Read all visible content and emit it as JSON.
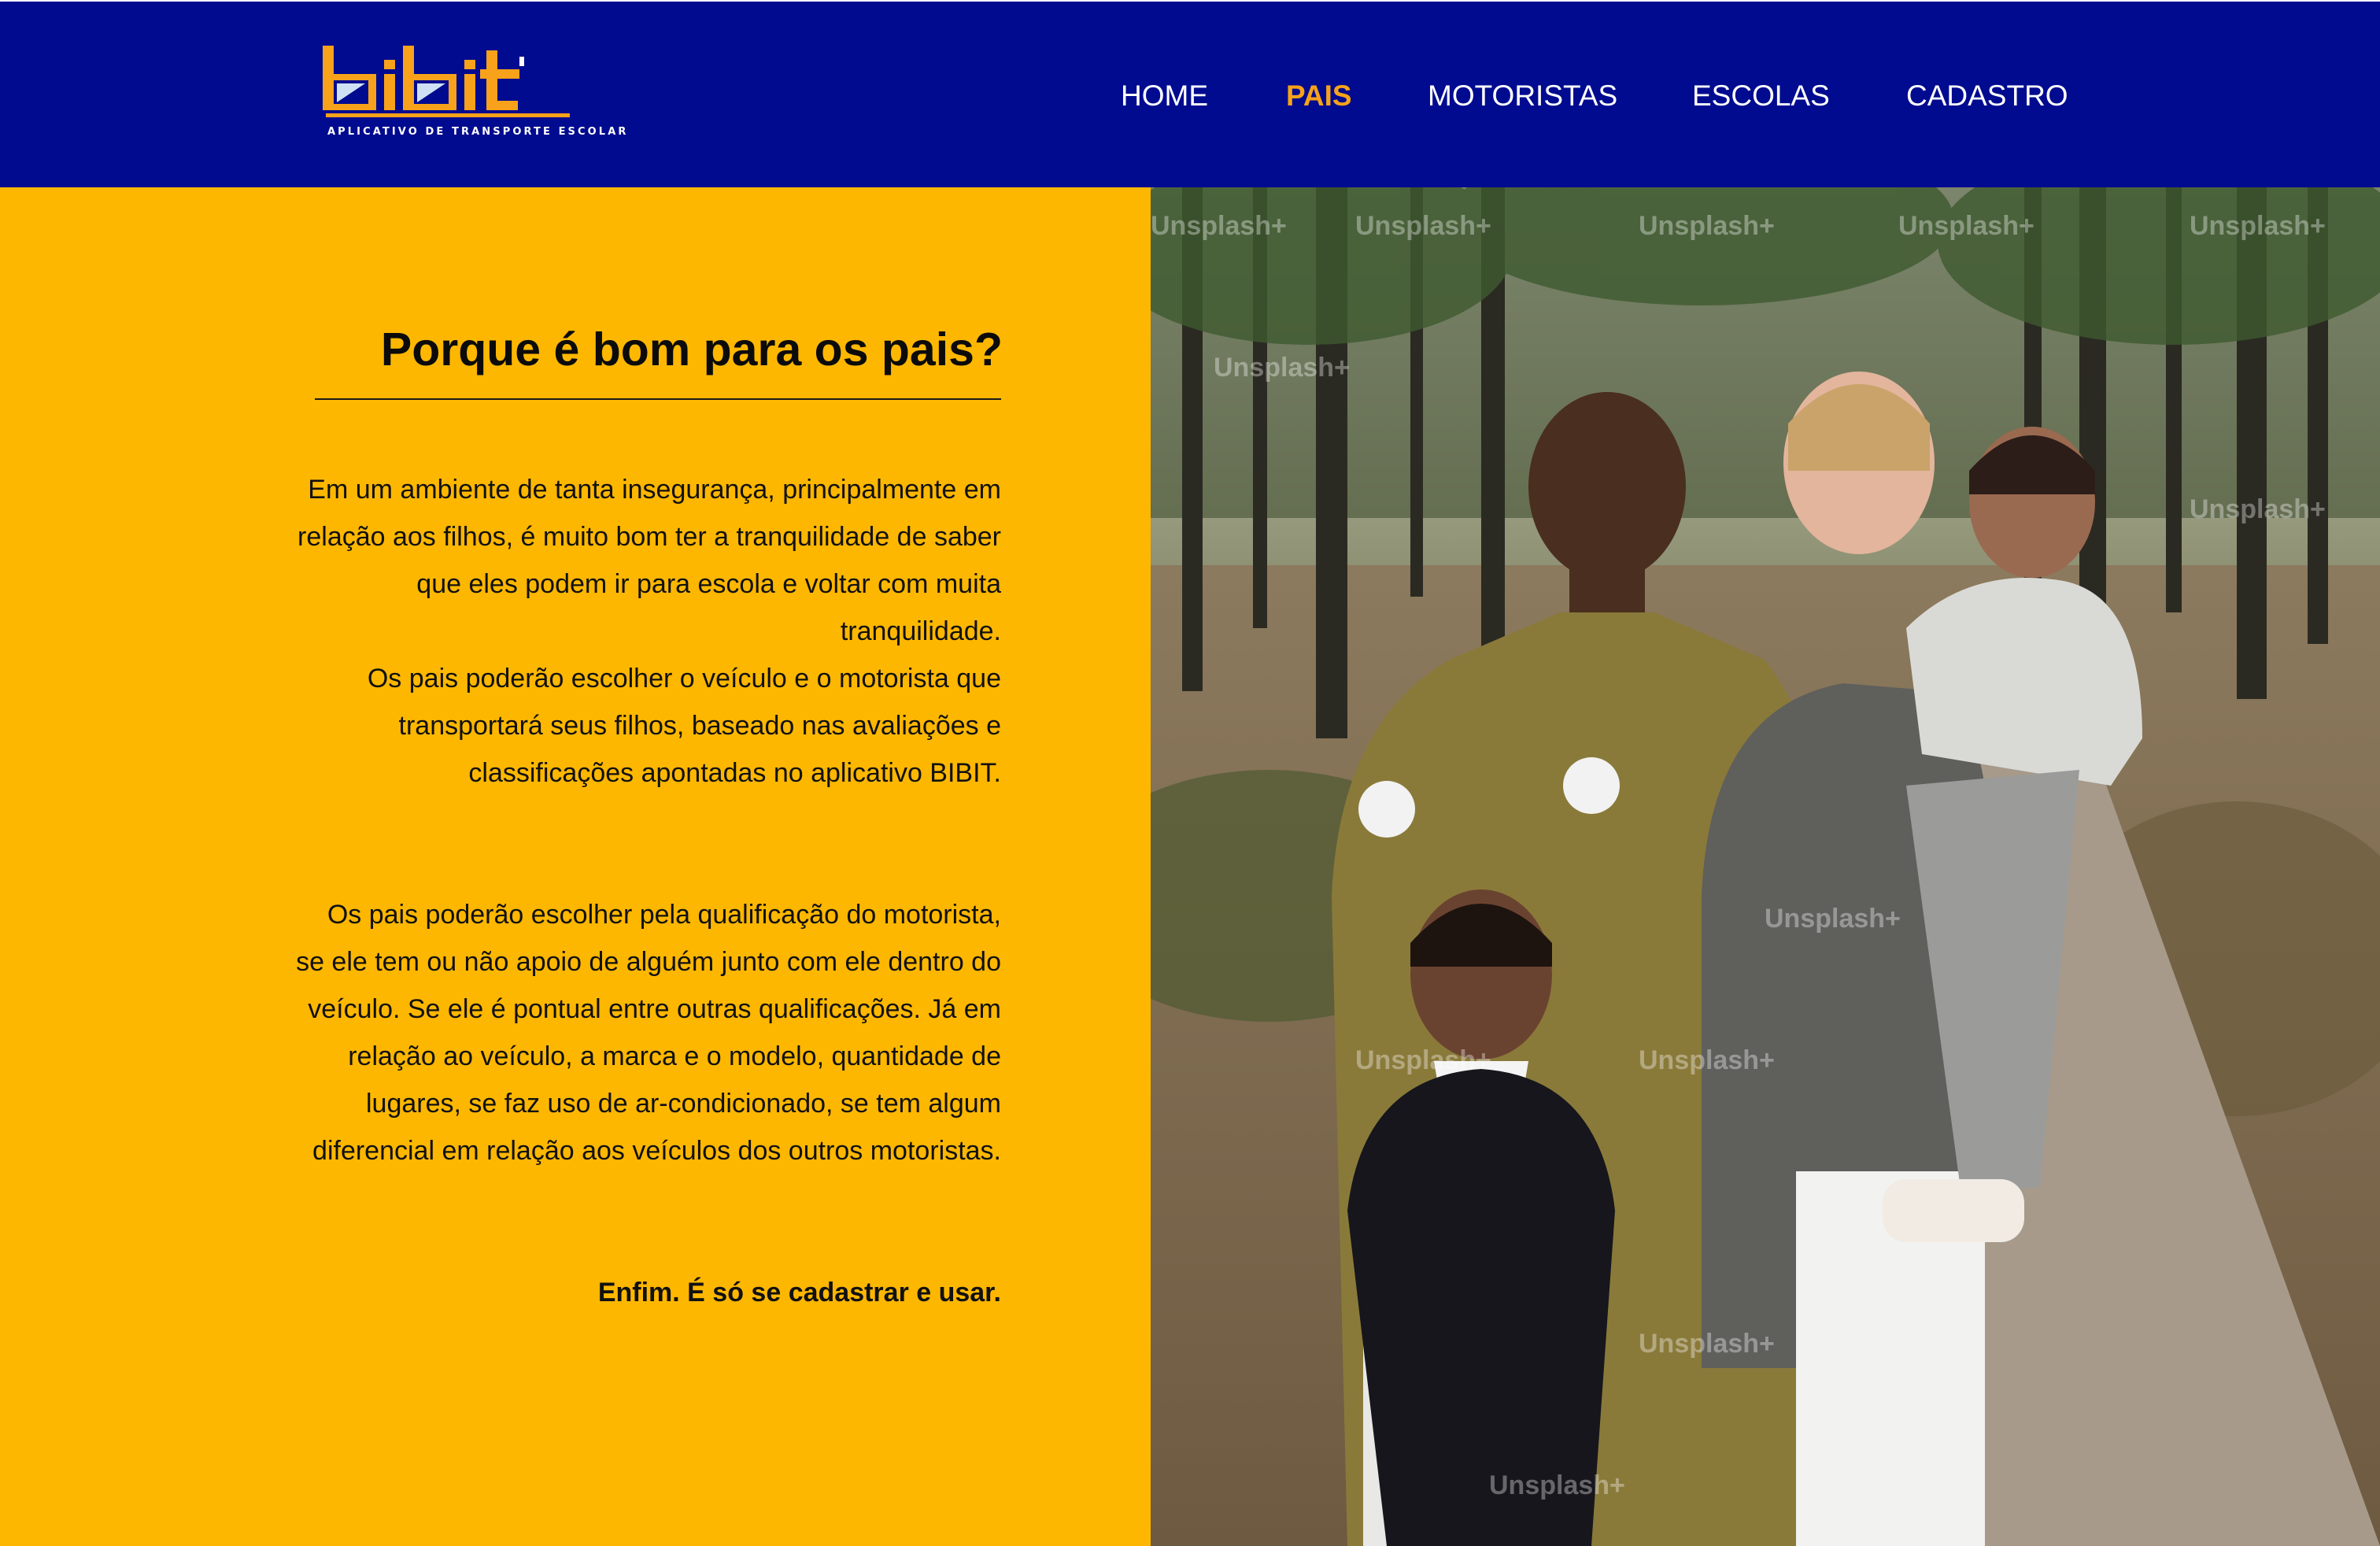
{
  "header": {
    "logo_text": "bibit",
    "tagline": "APLICATIVO DE TRANSPORTE ESCOLAR",
    "nav": [
      {
        "label": "HOME"
      },
      {
        "label": "PAIS",
        "active": true
      },
      {
        "label": "MOTORISTAS"
      },
      {
        "label": "ESCOLAS"
      },
      {
        "label": "CADASTRO"
      }
    ]
  },
  "main": {
    "title": "Porque é bom para os pais?",
    "paragraphs": [
      "Em um ambiente de tanta insegurança, principalmente em relação aos filhos, é muito bom ter a tranquilidade de saber que eles podem ir para escola e voltar com muita tranquilidade.",
      "Os pais poderão escolher o veículo e o motorista que transportará seus filhos, baseado nas avaliações e classificações apontadas no aplicativo BIBIT.",
      "Os pais poderão escolher pela qualificação do motorista, se ele tem ou não apoio de alguém junto com ele dentro do veículo. Se ele é pontual entre outras qualificações. Já em relação ao veículo, a marca e o modelo, quantidade de lugares, se faz uso de ar-condicionado, se tem algum diferencial em relação aos veículos dos outros motoristas.",
      "Enfim. É só se cadastrar e usar."
    ]
  },
  "photo": {
    "watermark": "Unsplash+"
  },
  "colors": {
    "header_bg": "#000b8f",
    "accent_orange": "#f7a21a",
    "panel_yellow": "#feb700",
    "text_dark": "#111111"
  }
}
